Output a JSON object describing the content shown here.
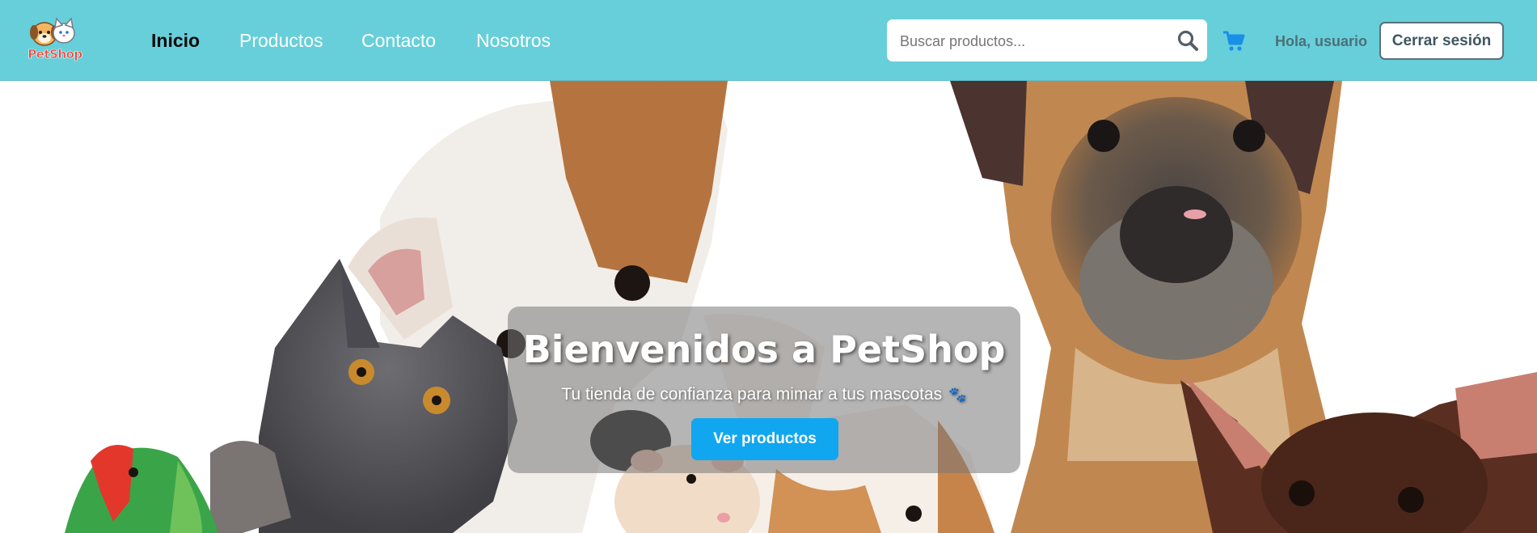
{
  "brand": {
    "logo_text": "PetShop"
  },
  "nav": {
    "links": [
      {
        "label": "Inicio",
        "active": true
      },
      {
        "label": "Productos",
        "active": false
      },
      {
        "label": "Contacto",
        "active": false
      },
      {
        "label": "Nosotros",
        "active": false
      }
    ]
  },
  "search": {
    "placeholder": "Buscar productos...",
    "value": ""
  },
  "user": {
    "greeting": "Hola, usuario",
    "logout_label": "Cerrar sesión"
  },
  "hero": {
    "title": "Bienvenidos a PetShop",
    "subtitle": "Tu tienda de confianza para mimar a tus mascotas",
    "cta_label": "Ver productos"
  },
  "icons": {
    "search": "search-icon",
    "cart": "shopping-cart-icon",
    "paw": "paw-icon"
  },
  "colors": {
    "navbar": "#67cfd9",
    "accent": "#10a6f0",
    "cart": "#1a8fe8"
  }
}
